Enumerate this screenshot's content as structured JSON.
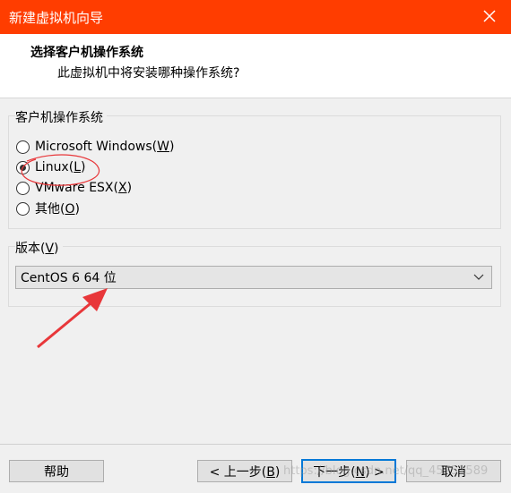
{
  "window": {
    "title": "新建虚拟机向导"
  },
  "header": {
    "title": "选择客户机操作系统",
    "subtitle": "此虚拟机中将安装哪种操作系统?"
  },
  "guest_os": {
    "label": "客户机操作系统",
    "options": [
      {
        "text": "Microsoft Windows(",
        "key": "W",
        "end": ")",
        "selected": false
      },
      {
        "text": "Linux(",
        "key": "L",
        "end": ")",
        "selected": true
      },
      {
        "text": "VMware ESX(",
        "key": "X",
        "end": ")",
        "selected": false
      },
      {
        "text": "其他(",
        "key": "O",
        "end": ")",
        "selected": false
      }
    ]
  },
  "version": {
    "label_text": "版本(",
    "label_key": "V",
    "label_end": ")",
    "selected": "CentOS 6 64 位"
  },
  "buttons": {
    "help": "帮助",
    "back_text": "< 上一步(",
    "back_key": "B",
    "back_end": ")",
    "next_text": "下一步(",
    "next_key": "N",
    "next_end": ") >",
    "cancel": "取消"
  },
  "watermark": "https://blog.csdn.net/qq_45751589",
  "colors": {
    "titlebar": "#ff3d00",
    "annotation": "#e8373a",
    "default_button_border": "#0078d7"
  }
}
